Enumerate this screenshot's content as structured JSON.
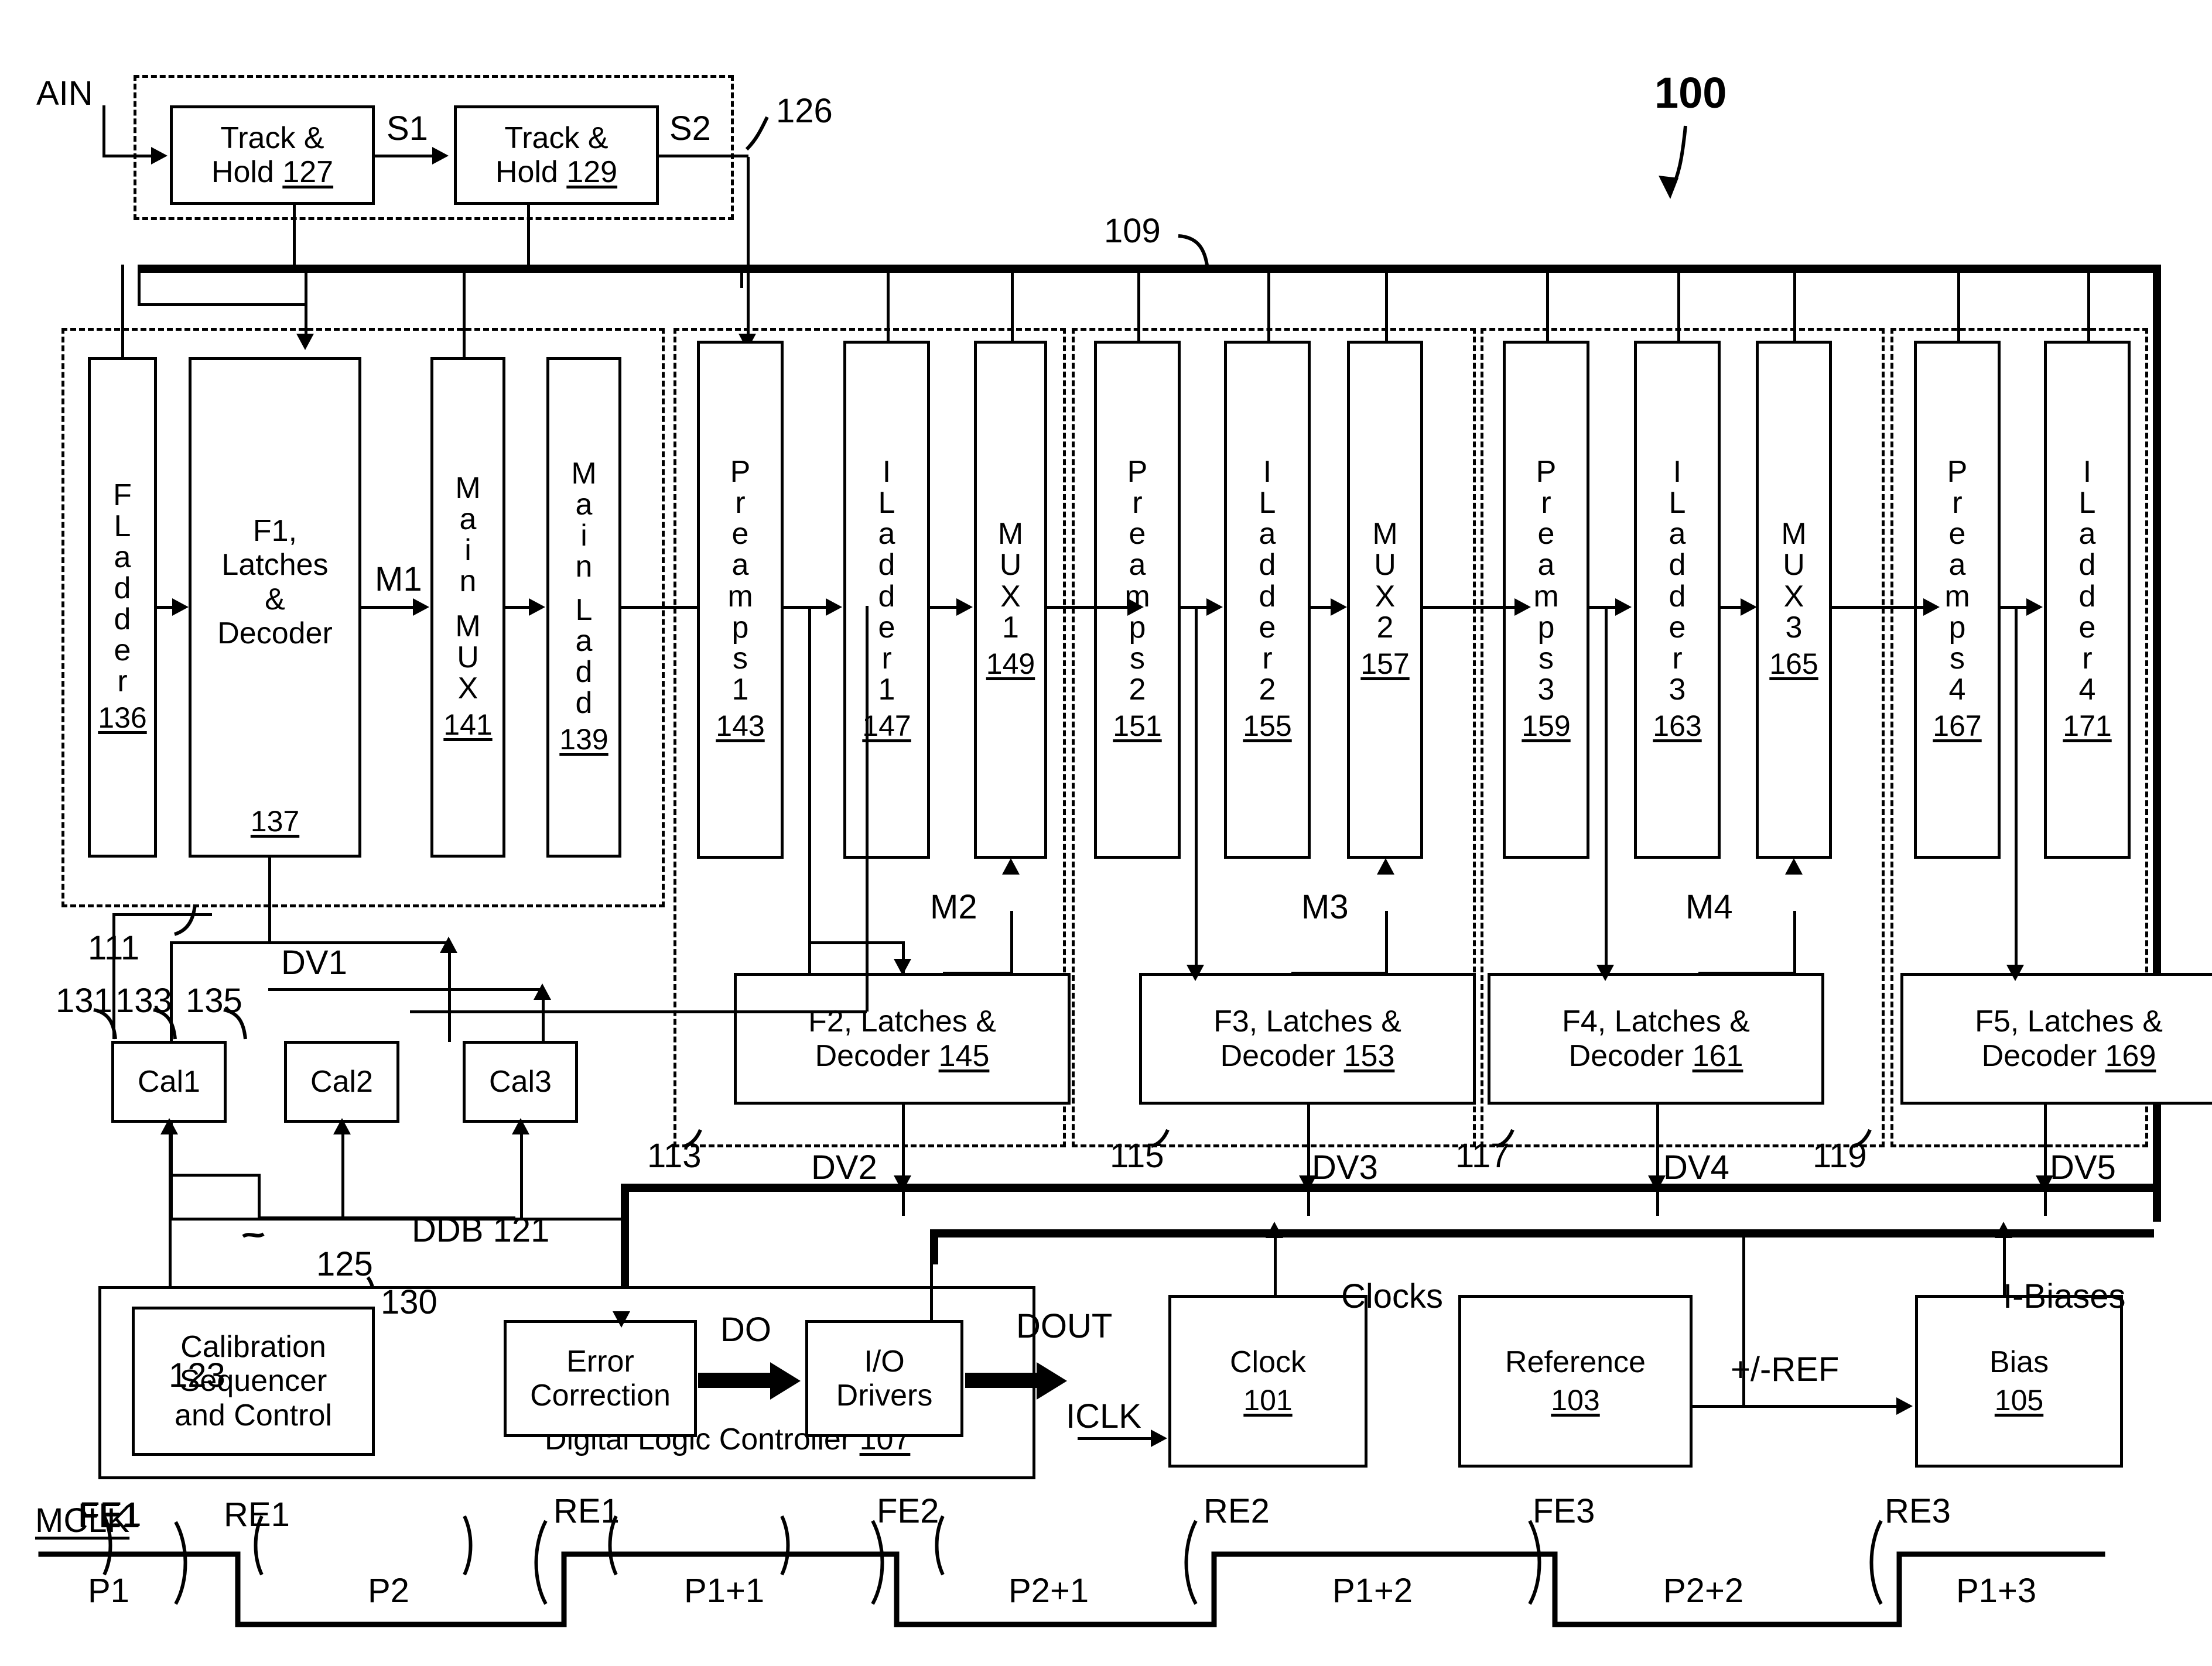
{
  "figure": {
    "number": "100",
    "bus_top_ref": "109",
    "bus_bottom_ref": "DDB 121",
    "ain_label": "AIN",
    "th_group_ref": "126"
  },
  "track_hold": {
    "block1": {
      "line1": "Track &",
      "line2": "Hold",
      "ref": "127"
    },
    "block2": {
      "line1": "Track &",
      "line2": "Hold",
      "ref": "129"
    },
    "s1": "S1",
    "s2": "S2"
  },
  "groups": [
    {
      "ref": "111"
    },
    {
      "ref": "113"
    },
    {
      "ref": "115"
    },
    {
      "ref": "117"
    },
    {
      "ref": "119"
    }
  ],
  "stage1": {
    "fladder": {
      "letters": [
        "F",
        "L",
        "a",
        "d",
        "d",
        "e",
        "r"
      ],
      "ref": "136"
    },
    "f1": {
      "line1": "F1,",
      "line2": "Latches",
      "line3": "&",
      "line4": "Decoder",
      "ref": "137"
    },
    "mainmux": {
      "letters": [
        "M",
        "a",
        "i",
        "n",
        "",
        "M",
        "U",
        "X"
      ],
      "ref": "141"
    },
    "mainladd": {
      "letters": [
        "M",
        "a",
        "i",
        "n",
        "",
        "L",
        "a",
        "d",
        "d"
      ],
      "ref": "139"
    },
    "m1": "M1"
  },
  "stage2": {
    "preamps": {
      "letters": [
        "P",
        "r",
        "e",
        "a",
        "m",
        "p",
        "s",
        "1"
      ],
      "ref": "143"
    },
    "iladder": {
      "letters": [
        "I",
        "L",
        "a",
        "d",
        "d",
        "e",
        "r",
        "1"
      ],
      "ref": "147"
    },
    "mux": {
      "letters": [
        "M",
        "U",
        "X",
        "1"
      ],
      "ref": "149"
    },
    "m": "M2",
    "latches": {
      "line1": "F2, Latches &",
      "line2": "Decoder ",
      "ref": "145"
    },
    "dv": "DV2"
  },
  "stage3": {
    "preamps": {
      "letters": [
        "P",
        "r",
        "e",
        "a",
        "m",
        "p",
        "s",
        "2"
      ],
      "ref": "151"
    },
    "iladder": {
      "letters": [
        "I",
        "L",
        "a",
        "d",
        "d",
        "e",
        "r",
        "2"
      ],
      "ref": "155"
    },
    "mux": {
      "letters": [
        "M",
        "U",
        "X",
        "2"
      ],
      "ref": "157"
    },
    "m": "M3",
    "latches": {
      "line1": "F3, Latches &",
      "line2": "Decoder ",
      "ref": "153"
    },
    "dv": "DV3"
  },
  "stage4": {
    "preamps": {
      "letters": [
        "P",
        "r",
        "e",
        "a",
        "m",
        "p",
        "s",
        "3"
      ],
      "ref": "159"
    },
    "iladder": {
      "letters": [
        "I",
        "L",
        "a",
        "d",
        "d",
        "e",
        "r",
        "3"
      ],
      "ref": "163"
    },
    "mux": {
      "letters": [
        "M",
        "U",
        "X",
        "3"
      ],
      "ref": "165"
    },
    "m": "M4",
    "latches": {
      "line1": "F4, Latches &",
      "line2": "Decoder ",
      "ref": "161"
    },
    "dv": "DV4"
  },
  "stage5": {
    "preamps": {
      "letters": [
        "P",
        "r",
        "e",
        "a",
        "m",
        "p",
        "s",
        "4"
      ],
      "ref": "167"
    },
    "iladder": {
      "letters": [
        "I",
        "L",
        "a",
        "d",
        "d",
        "e",
        "r",
        "4"
      ],
      "ref": "171"
    },
    "latches": {
      "line1": "F5, Latches &",
      "line2": "Decoder ",
      "ref": "169"
    },
    "dv": "DV5"
  },
  "calibration": {
    "dv1": "DV1",
    "cal1": {
      "label": "Cal1",
      "ref": "131"
    },
    "cal2": {
      "label": "Cal2",
      "ref": "133"
    },
    "cal3": {
      "label": "Cal3",
      "ref": "135"
    }
  },
  "controller": {
    "title": "Digital Logic Controller ",
    "title_ref": "107",
    "sequencer": {
      "line1": "Calibration",
      "line2": "Sequencer",
      "line3": "and Control",
      "ref": "130"
    },
    "error_correction": {
      "line1": "Error",
      "line2": "Correction",
      "ref": "123"
    },
    "io_drivers": {
      "line1": "I/O",
      "line2": "Drivers",
      "ref": "125"
    },
    "do_label": "DO",
    "dout_label": "DOUT"
  },
  "support": {
    "clock": {
      "label": "Clock",
      "ref": "101"
    },
    "reference": {
      "label": "Reference",
      "ref": "103"
    },
    "bias": {
      "label": "Bias",
      "ref": "105"
    },
    "iclk": "ICLK",
    "clocks": "Clocks",
    "ref_signal": "+/-REF",
    "ibiases": "I-Biases"
  },
  "timing": {
    "mclk": "MCLK",
    "edges": [
      "FE1",
      "RE1",
      "FE2",
      "RE2",
      "FE3",
      "RE3"
    ],
    "phases": [
      "P1",
      "P2",
      "P1+1",
      "P2+1",
      "P1+2",
      "P2+2",
      "P1+3"
    ]
  }
}
